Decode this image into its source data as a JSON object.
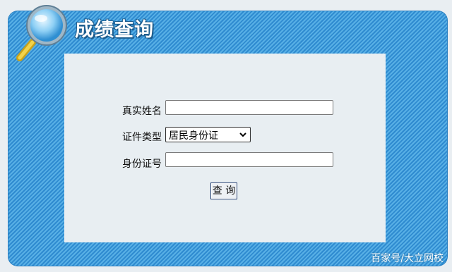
{
  "header": {
    "title": "成绩查询",
    "icon": "magnifier-icon"
  },
  "form": {
    "name_label": "真实姓名",
    "name_value": "",
    "id_type_label": "证件类型",
    "id_type_selected": "居民身份证",
    "id_number_label": "身份证号",
    "id_number_value": "",
    "submit_label": "查 询"
  },
  "watermark": "百家号/大立网校",
  "colors": {
    "frame_blue": "#3d9bd8",
    "panel_bg": "#e8eef2",
    "title_outline": "#1d5d8e"
  }
}
